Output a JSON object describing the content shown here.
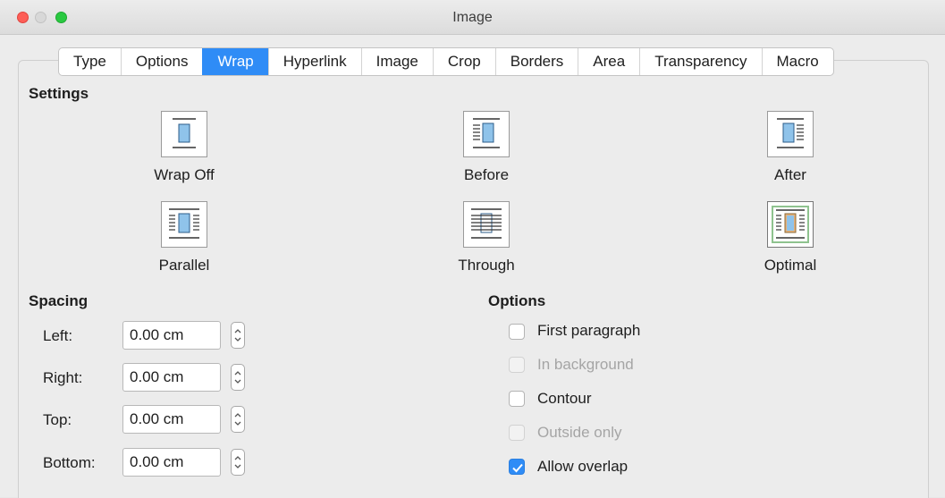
{
  "window": {
    "title": "Image"
  },
  "tabs": [
    {
      "label": "Type"
    },
    {
      "label": "Options"
    },
    {
      "label": "Wrap",
      "active": true
    },
    {
      "label": "Hyperlink"
    },
    {
      "label": "Image"
    },
    {
      "label": "Crop"
    },
    {
      "label": "Borders"
    },
    {
      "label": "Area"
    },
    {
      "label": "Transparency"
    },
    {
      "label": "Macro"
    }
  ],
  "settings": {
    "heading": "Settings",
    "options": [
      {
        "label": "Wrap Off"
      },
      {
        "label": "Before"
      },
      {
        "label": "After"
      },
      {
        "label": "Parallel"
      },
      {
        "label": "Through"
      },
      {
        "label": "Optimal",
        "selected": true
      }
    ]
  },
  "spacing": {
    "heading": "Spacing",
    "fields": [
      {
        "label": "Left:",
        "value": "0.00 cm"
      },
      {
        "label": "Right:",
        "value": "0.00 cm"
      },
      {
        "label": "Top:",
        "value": "0.00 cm"
      },
      {
        "label": "Bottom:",
        "value": "0.00 cm"
      }
    ]
  },
  "options": {
    "heading": "Options",
    "items": [
      {
        "label": "First paragraph",
        "checked": false,
        "enabled": true
      },
      {
        "label": "In background",
        "checked": false,
        "enabled": false
      },
      {
        "label": "Contour",
        "checked": false,
        "enabled": true
      },
      {
        "label": "Outside only",
        "checked": false,
        "enabled": false
      },
      {
        "label": "Allow overlap",
        "checked": true,
        "enabled": true
      }
    ]
  },
  "colors": {
    "accent": "#2f8cf6",
    "image_fill": "#8fc3ea",
    "optimal_border": "#8fc38f"
  },
  "icons": {
    "stepper": "up-down-arrows-icon",
    "check": "checkmark-icon"
  }
}
